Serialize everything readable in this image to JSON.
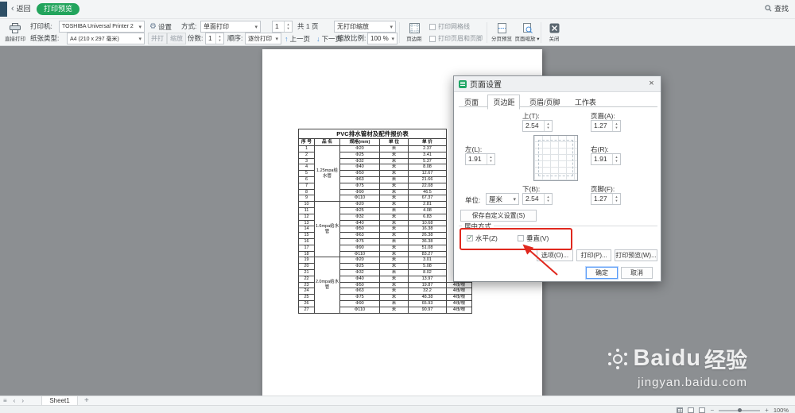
{
  "topbar": {
    "back": "返回",
    "badge": "打印预览",
    "find": "查找"
  },
  "toolbar": {
    "direct_print": "直接打印",
    "printer_label": "打印机:",
    "printer_value": "TOSHIBA Universal Printer 2",
    "settings": "设置",
    "paper_label": "纸张类型:",
    "paper_value": "A4 (210 x 297 毫米)",
    "duplex_btn": "并打",
    "zoom_btn": "缩放",
    "method_label": "方式:",
    "method_value": "单面打印",
    "copies_label": "份数:",
    "copies_value": "1",
    "order_label": "顺序:",
    "order_value": "逐份打印",
    "page_current": "1",
    "page_total": "共 1 页",
    "prev_page": "上一页",
    "next_page": "下一页",
    "scale_mode": "无打印缩放",
    "zoom_label": "缩放比例:",
    "zoom_value": "100 %",
    "margins_toggle": "页边距",
    "grid_checkbox": "打印网格线",
    "header_footer_checkbox": "打印页眉和页脚",
    "paging_preview": "分页预览",
    "page_zoom": "页面缩放",
    "close": "关闭"
  },
  "page_table": {
    "title": "PVC排水管材及配件报价表",
    "headers": [
      "序 号",
      "品 名",
      "规格(mm)",
      "单 位",
      "单 价"
    ],
    "groups": [
      {
        "name": "1.25mpa给水管",
        "rows": [
          [
            1,
            "Φ20",
            "米",
            "2.37"
          ],
          [
            2,
            "Φ25",
            "米",
            "3.41"
          ],
          [
            3,
            "Φ32",
            "米",
            "5.37"
          ],
          [
            4,
            "Φ40",
            "米",
            "8.08"
          ],
          [
            5,
            "Φ50",
            "米",
            "12.67"
          ],
          [
            6,
            "Φ63",
            "米",
            "21.66"
          ],
          [
            7,
            "Φ75",
            "米",
            "22.08"
          ],
          [
            8,
            "Φ90",
            "米",
            "46.5"
          ],
          [
            9,
            "Φ110",
            "米",
            "67.37"
          ]
        ]
      },
      {
        "name": "1.6mpa给水管",
        "rows": [
          [
            10,
            "Φ20",
            "米",
            "2.81"
          ],
          [
            11,
            "Φ25",
            "米",
            "4.08"
          ],
          [
            12,
            "Φ32",
            "米",
            "6.83"
          ],
          [
            13,
            "Φ40",
            "米",
            "10.68"
          ],
          [
            14,
            "Φ50",
            "米",
            "16.38"
          ],
          [
            15,
            "Φ63",
            "米",
            "26.38"
          ],
          [
            16,
            "Φ75",
            "米",
            "36.38"
          ],
          [
            17,
            "Φ90",
            "米",
            "51.08"
          ],
          [
            18,
            "Φ110",
            "米",
            "83.27"
          ]
        ]
      },
      {
        "name": "2.0mpa给水管",
        "rows": [
          [
            19,
            "Φ20",
            "米",
            "3.01"
          ],
          [
            20,
            "Φ25",
            "米",
            "5.08"
          ],
          [
            21,
            "Φ32",
            "米",
            "8.02"
          ],
          [
            22,
            "Φ40",
            "米",
            "13.97"
          ],
          [
            23,
            "Φ50",
            "米",
            "19.87",
            "4线/根"
          ],
          [
            24,
            "Φ63",
            "米",
            "32.2",
            "4线/根"
          ],
          [
            25,
            "Φ75",
            "米",
            "48.38",
            "4线/根"
          ],
          [
            26,
            "Φ90",
            "米",
            "65.93",
            "4线/根"
          ],
          [
            27,
            "Φ110",
            "米",
            "90.97",
            "4线/根"
          ]
        ]
      }
    ]
  },
  "dialog": {
    "title": "页面设置",
    "tabs": [
      "页面",
      "页边距",
      "页眉/页脚",
      "工作表"
    ],
    "active_tab": "页边距",
    "margins": {
      "top_label": "上(T):",
      "top": "2.54",
      "header_label": "页眉(A):",
      "header": "1.27",
      "left_label": "左(L):",
      "left": "1.91",
      "right_label": "右(R):",
      "right": "1.91",
      "bottom_label": "下(B):",
      "bottom": "2.54",
      "footer_label": "页脚(F):",
      "footer": "1.27",
      "unit_label": "单位:",
      "unit": "厘米"
    },
    "save_custom": "保存自定义设置(S)",
    "center": {
      "group_label": "居中方式",
      "horizontal_label": "水平(Z)",
      "horizontal_checked": true,
      "vertical_label": "垂直(V)",
      "vertical_checked": false
    },
    "options_btn": "选项(O)...",
    "print_btn": "打印(P)...",
    "preview_btn": "打印预览(W)...",
    "ok_btn": "确定",
    "cancel_btn": "取消"
  },
  "sheetbar": {
    "sheet": "Sheet1"
  },
  "statusbar": {
    "zoom": "100%"
  },
  "watermark": {
    "brand": "Baidu",
    "brand_suffix": "经验",
    "domain": "jingyan.baidu.com"
  },
  "colors": {
    "accent_green": "#22a45c",
    "annotation_red": "#e0281e",
    "canvas_gray": "#8c8f92"
  }
}
